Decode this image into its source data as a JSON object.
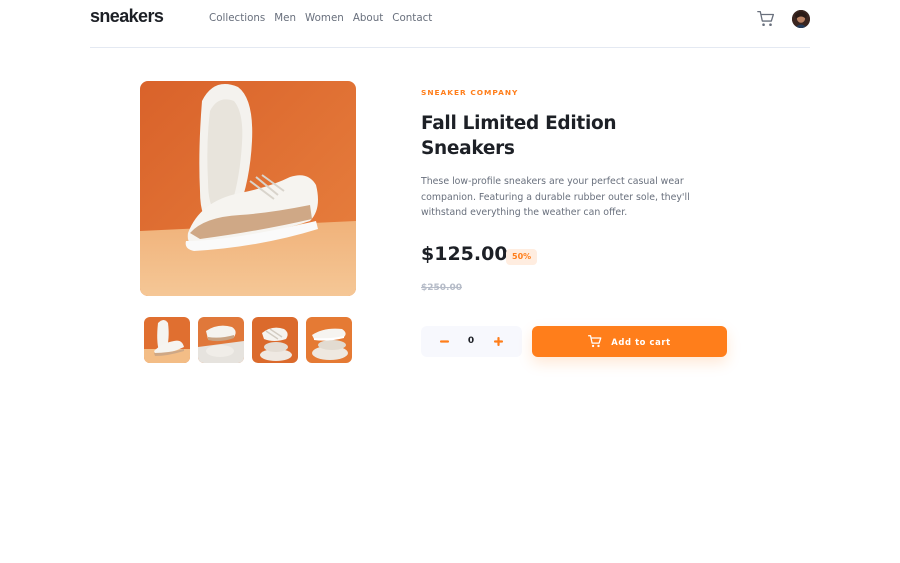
{
  "header": {
    "logo": "sneakers",
    "nav": [
      "Collections",
      "Men",
      "Women",
      "About",
      "Contact"
    ],
    "cart_icon": "cart-icon",
    "avatar_icon": "user-avatar"
  },
  "product": {
    "company": "SNEAKER COMPANY",
    "title_line1": "Fall Limited Edition",
    "title_line2": "Sneakers",
    "description": "These low-profile sneakers are your perfect casual wear companion. Featuring a durable rubber outer sole, they'll withstand everything the weather can offer.",
    "price": "$125.00",
    "discount": "50%",
    "original_price": "$250.00"
  },
  "gallery": {
    "main_image": "sneaker-product-image",
    "thumbnails": [
      "thumbnail-1",
      "thumbnail-2",
      "thumbnail-3",
      "thumbnail-4"
    ]
  },
  "cart_controls": {
    "quantity": "0",
    "minus_icon": "minus-icon",
    "plus_icon": "plus-icon",
    "add_to_cart_label": "Add to cart"
  },
  "colors": {
    "accent": "#ff7e1b",
    "accent_pale": "#ffede0",
    "dark": "#1d2026",
    "grey_text": "#69707d",
    "light_grey": "#b6bcc8",
    "bg_light": "#f7f8fd"
  }
}
